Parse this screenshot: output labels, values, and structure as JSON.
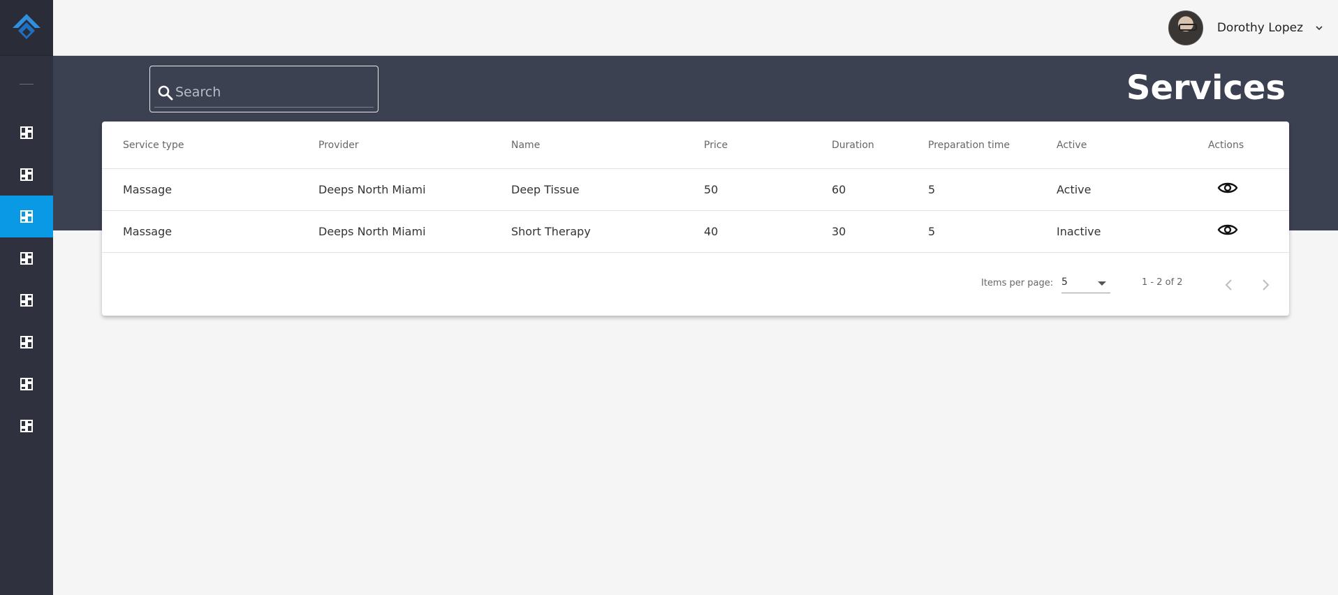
{
  "header": {
    "user_name": "Dorothy Lopez"
  },
  "search": {
    "placeholder": "Search"
  },
  "page": {
    "title": "Services"
  },
  "sidebar": {
    "items": [
      {
        "icon": "dashboard-icon",
        "active": false
      },
      {
        "icon": "dashboard-icon",
        "active": false
      },
      {
        "icon": "dashboard-icon",
        "active": true
      },
      {
        "icon": "dashboard-icon",
        "active": false
      },
      {
        "icon": "dashboard-icon",
        "active": false
      },
      {
        "icon": "dashboard-icon",
        "active": false
      },
      {
        "icon": "dashboard-icon",
        "active": false
      },
      {
        "icon": "dashboard-icon",
        "active": false
      }
    ]
  },
  "table": {
    "columns": [
      "Service type",
      "Provider",
      "Name",
      "Price",
      "Duration",
      "Preparation time",
      "Active",
      "Actions"
    ],
    "rows": [
      [
        "Massage",
        "Deeps North Miami",
        "Deep Tissue",
        "50",
        "60",
        "5",
        "Active"
      ],
      [
        "Massage",
        "Deeps North Miami",
        "Short Therapy",
        "40",
        "30",
        "5",
        "Inactive"
      ]
    ]
  },
  "pagination": {
    "items_per_page_label": "Items per page:",
    "items_per_page": "5",
    "range": "1 - 2 of 2"
  },
  "colors": {
    "sidebar_bg": "#2f323e",
    "accent": "#0a9ae5",
    "band_bg": "#3c4152"
  }
}
